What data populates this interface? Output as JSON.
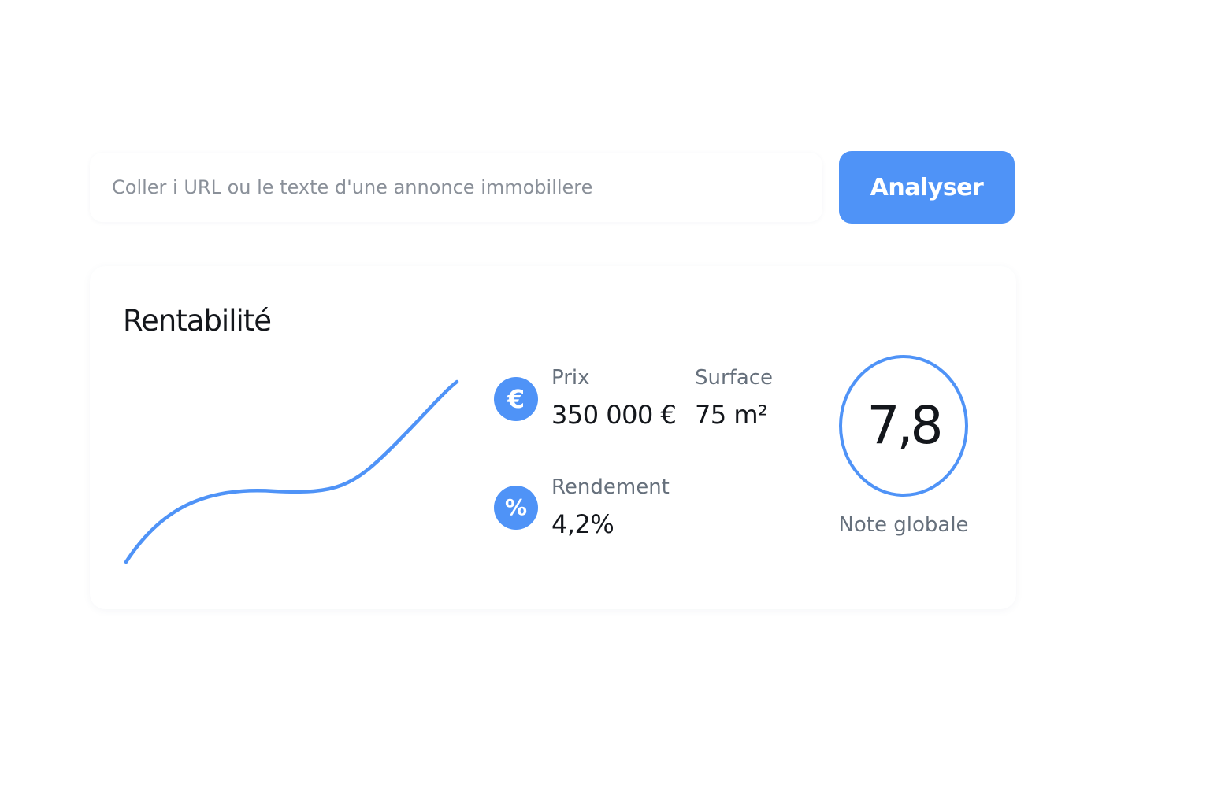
{
  "search": {
    "placeholder": "Coller i URL ou le texte d'une annonce immobillere",
    "button_label": "Analyser"
  },
  "result": {
    "title": "Rentabilité",
    "price": {
      "label": "Prix",
      "value": "350 000 €",
      "icon": "euro-icon",
      "icon_glyph": "€"
    },
    "surface": {
      "label": "Surface",
      "value": "75 m²"
    },
    "yield": {
      "label": "Rendement",
      "value": "4,2%",
      "icon": "percent-icon",
      "icon_glyph": "%"
    },
    "score": {
      "value": "7,8",
      "caption": "Note globale"
    }
  },
  "colors": {
    "accent": "#4f93f7",
    "text_primary": "#14171c",
    "text_secondary": "#66707c",
    "placeholder": "#8a9099"
  }
}
